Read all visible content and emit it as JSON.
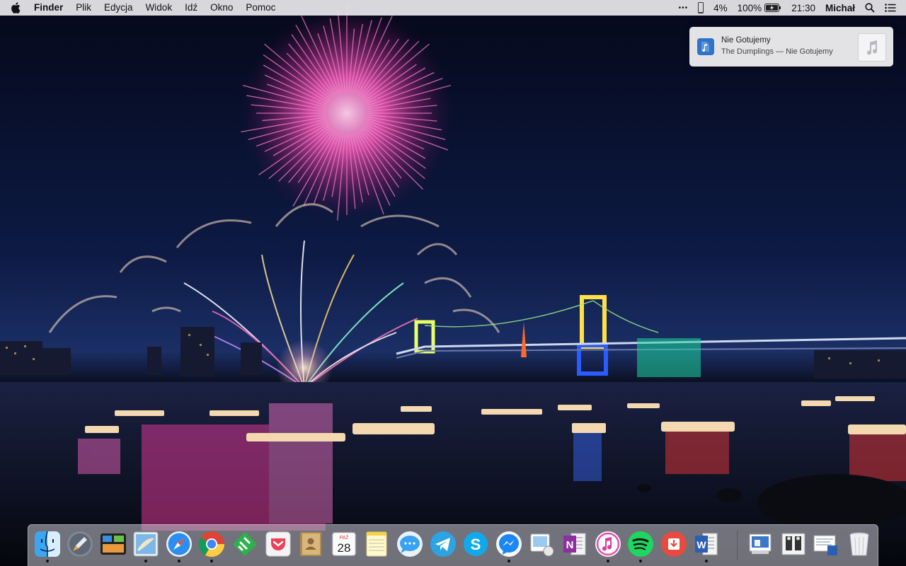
{
  "menubar": {
    "app_name": "Finder",
    "menus": [
      "Plik",
      "Edycja",
      "Widok",
      "Idź",
      "Okno",
      "Pomoc"
    ],
    "status": {
      "dots": "•••",
      "cpu": "4%",
      "battery": "100%",
      "time": "21:30",
      "user": "Michał"
    }
  },
  "notification": {
    "title": "Nie Gotujemy",
    "subtitle": "The Dumplings — Nie Gotujemy"
  },
  "dock": {
    "calendar": {
      "month": "PAŹ",
      "day": "28"
    },
    "apps": [
      {
        "name": "Finder",
        "icon": "finder-icon",
        "running": true
      },
      {
        "name": "Launchpad",
        "icon": "launchpad-icon",
        "running": false
      },
      {
        "name": "Mission Control",
        "icon": "mission-control-icon",
        "running": false
      },
      {
        "name": "Mail",
        "icon": "mail-icon",
        "running": true
      },
      {
        "name": "Safari",
        "icon": "safari-icon",
        "running": true
      },
      {
        "name": "Chrome",
        "icon": "chrome-icon",
        "running": true
      },
      {
        "name": "Feedly",
        "icon": "feedly-icon",
        "running": false
      },
      {
        "name": "Pocket",
        "icon": "pocket-icon",
        "running": false
      },
      {
        "name": "Contacts",
        "icon": "contacts-icon",
        "running": false
      },
      {
        "name": "Calendar",
        "icon": "calendar-icon",
        "running": false
      },
      {
        "name": "Notes",
        "icon": "notes-icon",
        "running": false
      },
      {
        "name": "Messages",
        "icon": "messages-icon",
        "running": false
      },
      {
        "name": "Telegram",
        "icon": "telegram-icon",
        "running": false
      },
      {
        "name": "Skype",
        "icon": "skype-icon",
        "running": false
      },
      {
        "name": "Messenger",
        "icon": "messenger-icon",
        "running": true
      },
      {
        "name": "Preview",
        "icon": "preview-icon",
        "running": false
      },
      {
        "name": "OneNote",
        "icon": "onenote-icon",
        "running": false
      },
      {
        "name": "iTunes",
        "icon": "itunes-icon",
        "running": true
      },
      {
        "name": "Spotify",
        "icon": "spotify-icon",
        "running": true
      },
      {
        "name": "Downloader",
        "icon": "downloader-icon",
        "running": false
      },
      {
        "name": "Word",
        "icon": "word-icon",
        "running": true
      }
    ],
    "stacks": [
      {
        "name": "Screenshots",
        "icon": "screenshot-stack-icon"
      },
      {
        "name": "Documents",
        "icon": "documents-stack-icon"
      },
      {
        "name": "Downloads",
        "icon": "downloads-stack-icon"
      },
      {
        "name": "Trash",
        "icon": "trash-icon"
      }
    ]
  },
  "colors": {
    "menubar_bg": "#e8e8eb",
    "sky_top": "#070a1c",
    "sky_bottom": "#162a5c",
    "firework_pink": "#ff4fb0",
    "firework_gold": "#ffd27a"
  }
}
